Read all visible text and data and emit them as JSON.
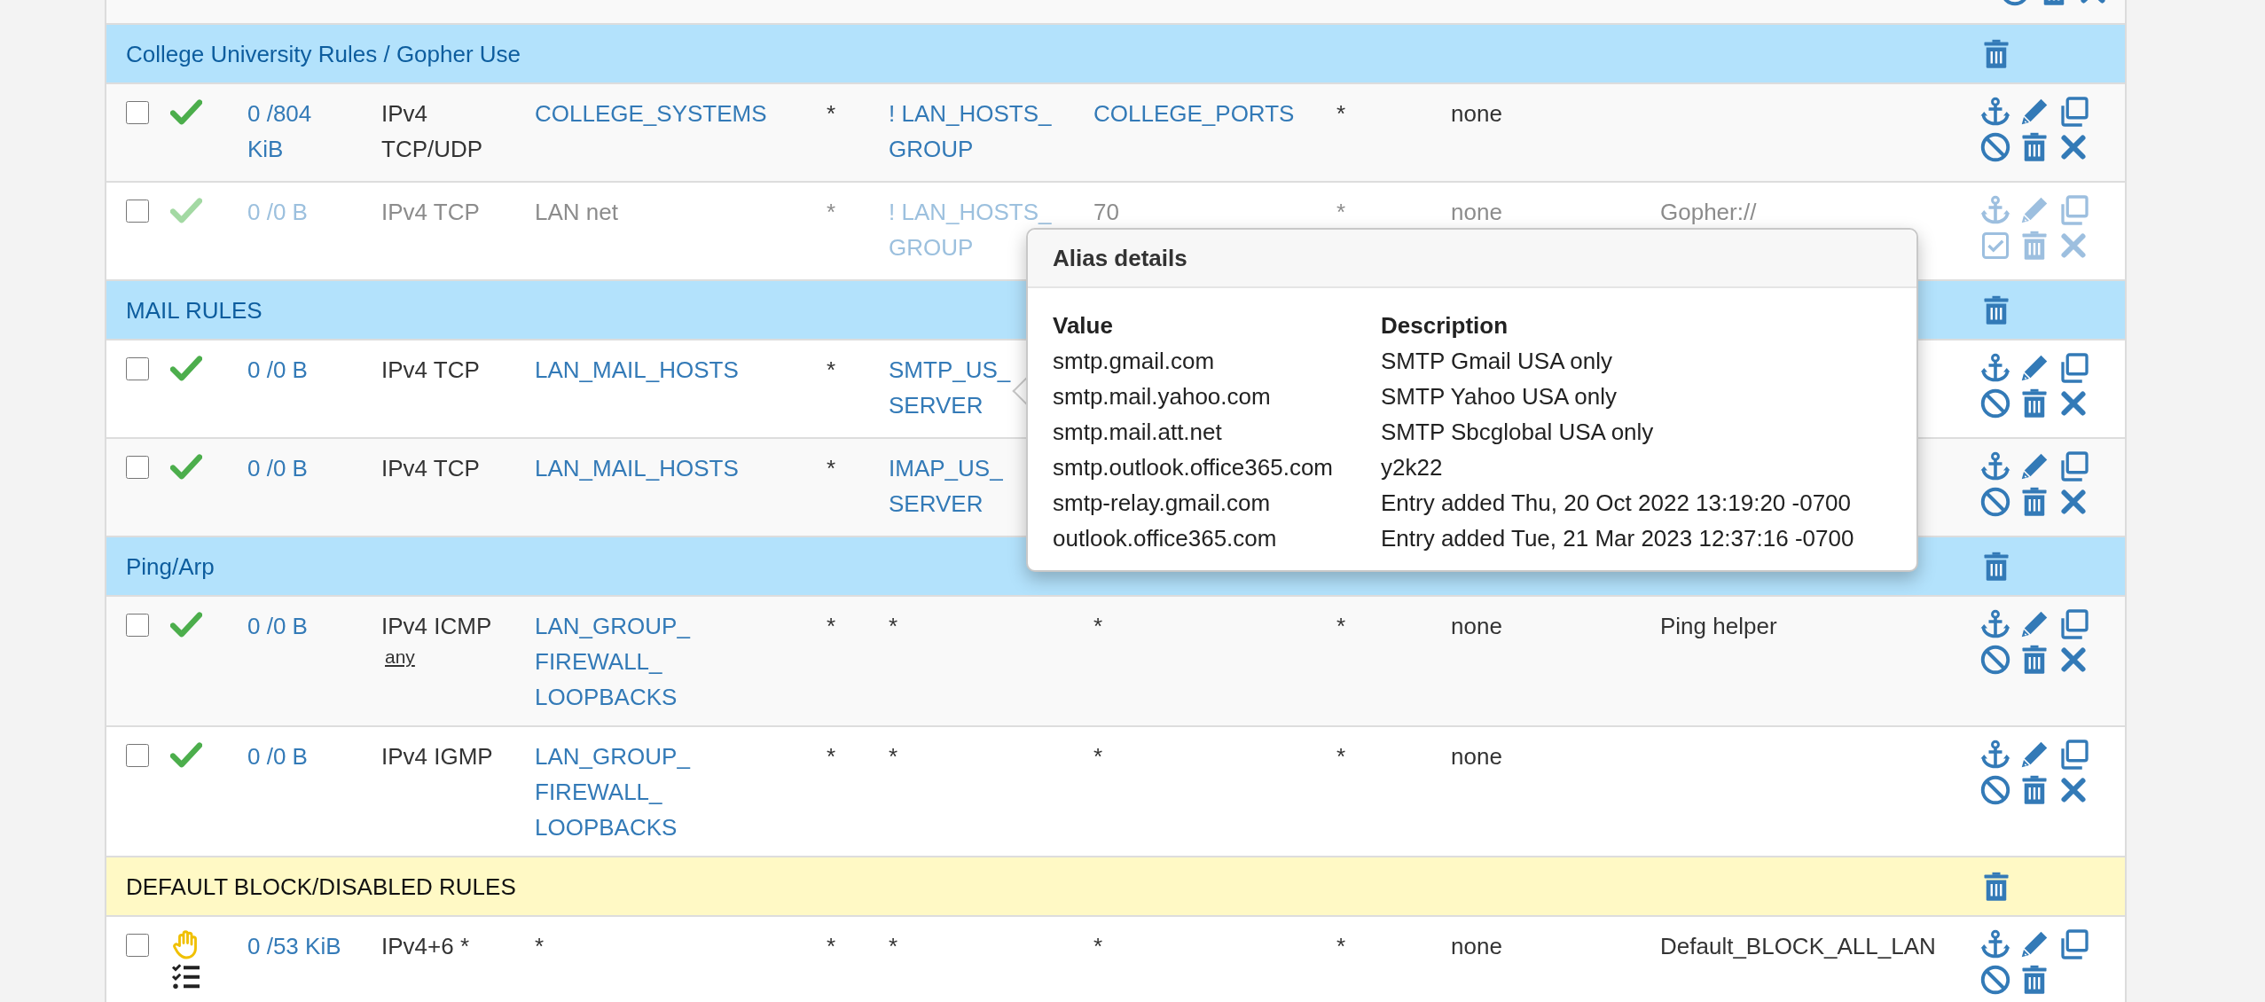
{
  "rows": [
    {
      "kind": "partial"
    },
    {
      "kind": "separator",
      "title": "College University Rules / Gopher Use",
      "color": "#b3e2fc"
    },
    {
      "kind": "pass_rule",
      "selected": false,
      "disabled": false,
      "logged": false,
      "states": "0 /804 KiB",
      "protocol": {
        "text": "IPv4 TCP/UDP"
      },
      "source": {
        "text": "COLLEGE_SYSTEMS",
        "alias": true
      },
      "source_port": "*",
      "destination": {
        "text": "! LAN_HOSTS_GROUP",
        "alias": true
      },
      "destination_port": {
        "text": "COLLEGE_PORTS",
        "alias": true
      },
      "gateway": "*",
      "queue": "none"
    },
    {
      "kind": "pass_rule",
      "selected": false,
      "disabled": true,
      "logged": false,
      "states": "0 /0 B",
      "protocol": {
        "text": "IPv4 TCP"
      },
      "source": {
        "text": "LAN net",
        "alias": false
      },
      "source_port": "*",
      "destination": {
        "text": "! LAN_HOSTS_GROUP",
        "alias": true
      },
      "destination_port": {
        "text": "70",
        "alias": false
      },
      "gateway": "*",
      "queue": "none",
      "description": "Gopher://"
    },
    {
      "kind": "separator",
      "title": "MAIL RULES",
      "color": "#b3e2fc"
    },
    {
      "kind": "pass_rule",
      "selected": false,
      "disabled": false,
      "logged": false,
      "states": "0 /0 B",
      "protocol": {
        "text": "IPv4 TCP"
      },
      "source": {
        "text": "LAN_MAIL_HOSTS",
        "alias": true
      },
      "source_port": "*",
      "destination": {
        "text": "SMTP_US_SERVER",
        "alias": true
      }
    },
    {
      "kind": "pass_rule",
      "selected": false,
      "disabled": false,
      "logged": false,
      "states": "0 /0 B",
      "protocol": {
        "text": "IPv4 TCP"
      },
      "source": {
        "text": "LAN_MAIL_HOSTS",
        "alias": true
      },
      "source_port": "*",
      "destination": {
        "text": "IMAP_US_SERVER",
        "alias": true
      }
    },
    {
      "kind": "separator",
      "title": "Ping/Arp",
      "color": "#b3e2fc"
    },
    {
      "kind": "pass_rule",
      "selected": false,
      "disabled": false,
      "logged": false,
      "states": "0 /0 B",
      "protocol": {
        "text": "IPv4 ICMP",
        "sub": "any"
      },
      "source": {
        "text": "LAN_GROUP_FIREWALL_LOOPBACKS",
        "alias": true
      },
      "source_port": "*",
      "destination": {
        "text": "*",
        "alias": false
      },
      "destination_port": {
        "text": "*",
        "alias": false
      },
      "gateway": "*",
      "queue": "none",
      "description": "Ping helper"
    },
    {
      "kind": "pass_rule",
      "selected": false,
      "disabled": false,
      "logged": false,
      "states": "0 /0 B",
      "protocol": {
        "text": "IPv4 IGMP"
      },
      "source": {
        "text": "LAN_GROUP_FIREWALL_LOOPBACKS",
        "alias": true
      },
      "source_port": "*",
      "destination": {
        "text": "*",
        "alias": false
      },
      "destination_port": {
        "text": "*",
        "alias": false
      },
      "gateway": "*",
      "queue": "none"
    },
    {
      "kind": "separator",
      "title": "DEFAULT BLOCK/DISABLED RULES",
      "color": "#fff9c5"
    },
    {
      "kind": "block_rule",
      "selected": false,
      "disabled": false,
      "logged": true,
      "states": "0 /53 KiB",
      "protocol": {
        "text": "IPv4+6 *"
      },
      "source": {
        "text": "*",
        "alias": false
      },
      "source_port": "*",
      "destination": {
        "text": "*",
        "alias": false
      },
      "destination_port": {
        "text": "*",
        "alias": false
      },
      "gateway": "*",
      "queue": "none",
      "description": "Default_BLOCK_ALL_LAN"
    }
  ],
  "popover": {
    "title": "Alias details",
    "columns": [
      "Value",
      "Description"
    ],
    "rows": [
      [
        "smtp.gmail.com",
        "SMTP Gmail USA only"
      ],
      [
        "smtp.mail.yahoo.com",
        "SMTP Yahoo USA only"
      ],
      [
        "smtp.mail.att.net",
        "SMTP Sbcglobal USA only"
      ],
      [
        "smtp.outlook.office365.com",
        "y2k22"
      ],
      [
        "smtp-relay.gmail.com",
        "Entry added Thu, 20 Oct 2022 13:19:20 -0700"
      ],
      [
        "outlook.office365.com",
        "Entry added Tue, 21 Mar 2023 12:37:16 -0700"
      ]
    ]
  }
}
